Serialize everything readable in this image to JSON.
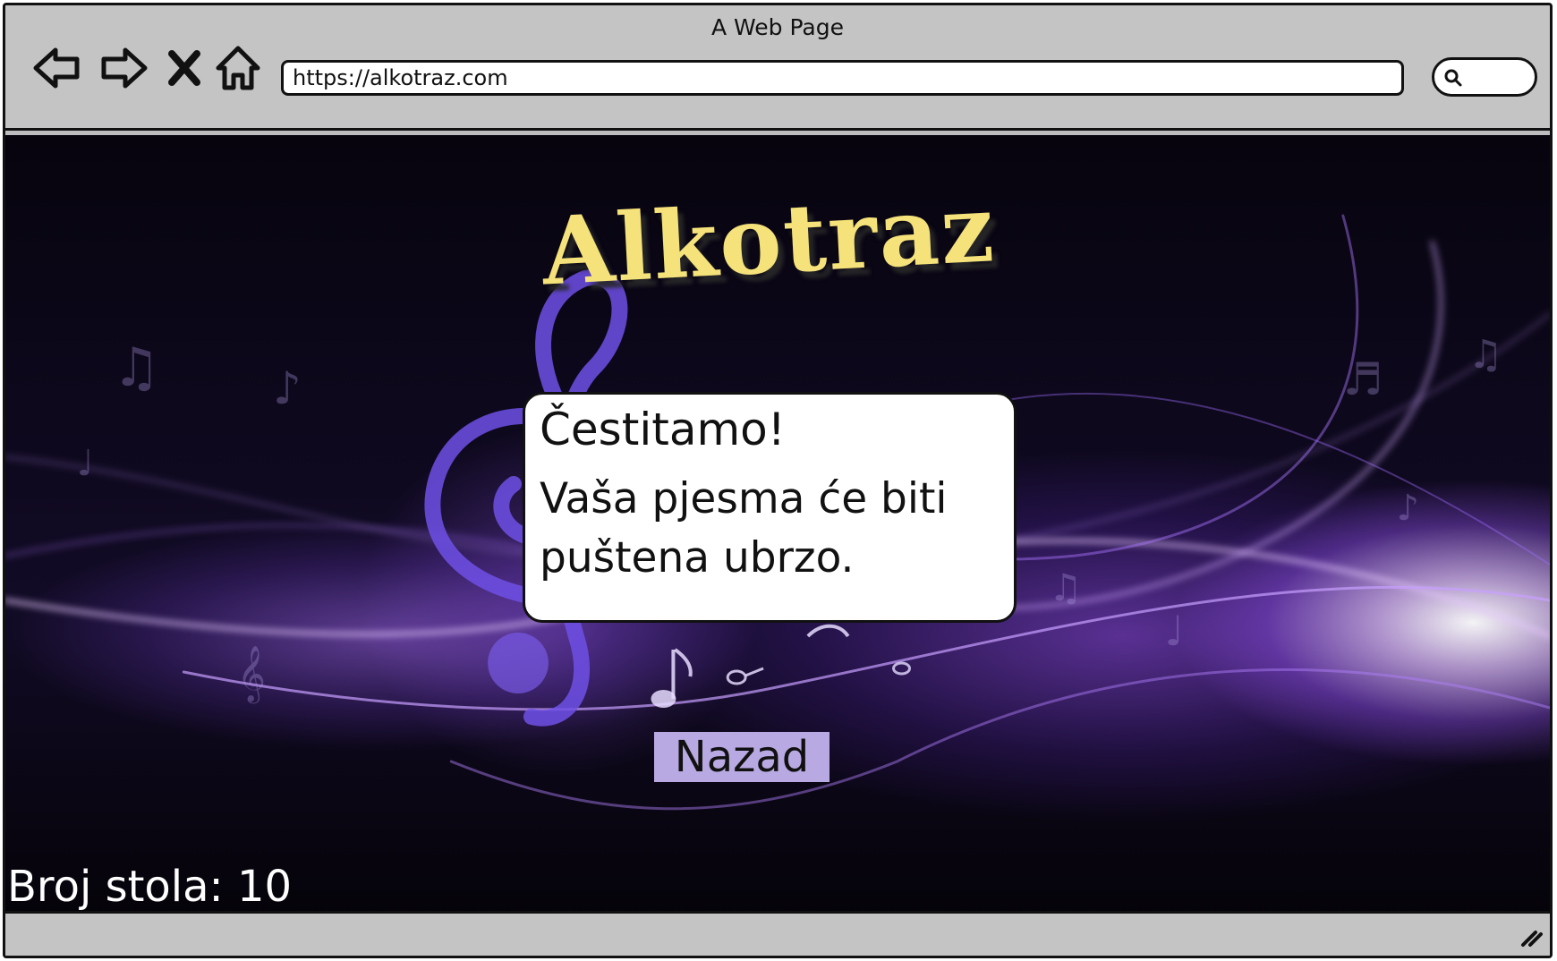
{
  "window": {
    "title": "A Web Page",
    "url": "https://alkotraz.com"
  },
  "nav": {
    "icons": [
      "back-arrow-icon",
      "forward-arrow-icon",
      "close-icon",
      "home-icon",
      "search-icon",
      "resize-grip-icon"
    ]
  },
  "page": {
    "logo_text": "Alkotraz",
    "dialog": {
      "title": "Čestitamo!",
      "message_line1": "Vaša pjesma će biti",
      "message_line2": "puštena ubrzo."
    },
    "back_button_label": "Nazad",
    "table_number": "Broj stola: 10"
  },
  "colors": {
    "logo": "#f5e27a",
    "button_bg": "#b9a9e2",
    "chrome_gray": "#c4c4c4",
    "glow_purple": "#a060ff"
  }
}
